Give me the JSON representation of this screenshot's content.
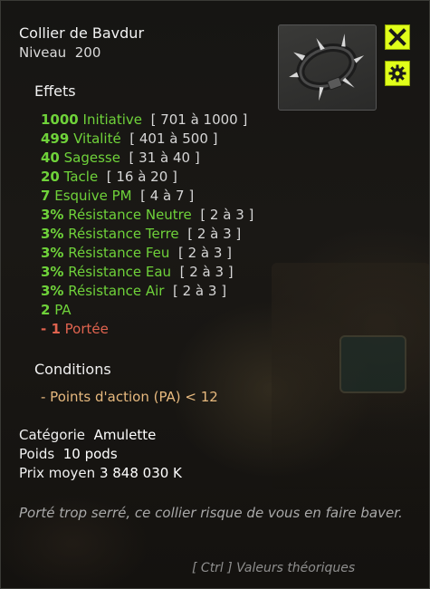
{
  "item": {
    "name": "Collier de Bavdur",
    "level_label": "Niveau",
    "level_value": "200",
    "image_icon": "spiked-collar-icon"
  },
  "effects": {
    "title": "Effets",
    "rows": [
      {
        "value": "1000",
        "label": "Initiative",
        "range": "[ 701 à 1000 ]"
      },
      {
        "value": "499",
        "label": "Vitalité",
        "range": "[ 401 à 500 ]"
      },
      {
        "value": "40",
        "label": "Sagesse",
        "range": "[ 31 à 40 ]"
      },
      {
        "value": "20",
        "label": "Tacle",
        "range": "[ 16 à 20 ]"
      },
      {
        "value": "7",
        "label": "Esquive PM",
        "range": "[ 4 à 7 ]"
      },
      {
        "value": "3%",
        "label": "Résistance Neutre",
        "range": "[ 2 à 3 ]"
      },
      {
        "value": "3%",
        "label": "Résistance Terre",
        "range": "[ 2 à 3 ]"
      },
      {
        "value": "3%",
        "label": "Résistance Feu",
        "range": "[ 2 à 3 ]"
      },
      {
        "value": "3%",
        "label": "Résistance Eau",
        "range": "[ 2 à 3 ]"
      },
      {
        "value": "3%",
        "label": "Résistance Air",
        "range": "[ 2 à 3 ]"
      },
      {
        "value": "2",
        "label": "PA",
        "range": ""
      }
    ],
    "negative": {
      "value": "- 1",
      "label": "Portée"
    }
  },
  "conditions": {
    "title": "Conditions",
    "items": [
      "- Points d'action (PA) < 12"
    ]
  },
  "meta": {
    "category_label": "Catégorie",
    "category_value": "Amulette",
    "weight_label": "Poids",
    "weight_value": "10 pods",
    "price_label": "Prix moyen",
    "price_value": "3 848 030 K"
  },
  "description": "Porté trop serré, ce collier risque de vous en faire baver.",
  "hint": "[ Ctrl ] Valeurs théoriques",
  "buttons": {
    "close_icon": "close-icon",
    "settings_icon": "gear-icon"
  },
  "colors": {
    "bonus": "#6fd23a",
    "malus": "#e0634f",
    "condition": "#e7b97e",
    "button": "#e0ff1a"
  }
}
